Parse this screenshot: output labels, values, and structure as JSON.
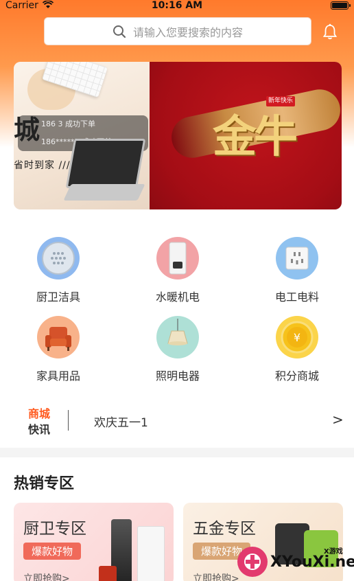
{
  "status_bar": {
    "carrier": "Carrier",
    "time": "10:16 AM"
  },
  "search": {
    "placeholder": "请输入您要搜索的内容"
  },
  "banner": {
    "ticker_row1": "186     3 成功下单",
    "ticker_row2": "186*****5 成功下单",
    "big_char": "城",
    "promo_line": "省时到家 ///",
    "badge": "新年快乐",
    "headline": "金牛"
  },
  "categories": [
    {
      "label": "厨卫洁具",
      "icon": "shower-head-icon"
    },
    {
      "label": "水暖机电",
      "icon": "water-heater-icon"
    },
    {
      "label": "电工电料",
      "icon": "power-socket-icon"
    },
    {
      "label": "家具用品",
      "icon": "sofa-icon"
    },
    {
      "label": "照明电器",
      "icon": "lamp-icon"
    },
    {
      "label": "积分商城",
      "icon": "coin-icon"
    }
  ],
  "news": {
    "tag_line1": "商城",
    "tag_line2": "快讯",
    "text": "欢庆五一1",
    "more": ">"
  },
  "hot": {
    "title": "热销专区",
    "zones": [
      {
        "title": "厨卫专区",
        "badge": "爆款好物",
        "buy": "立即抢购>",
        "color": "#f06a5a"
      },
      {
        "title": "五金专区",
        "badge": "爆款好物",
        "buy": "立即抢购>",
        "color": "#d9a574"
      }
    ]
  },
  "watermark": {
    "brand": "XYouXi.net",
    "small": "X游戏"
  },
  "colors": {
    "accent": "#ff7a2c",
    "news_tag": "#ff5a1f"
  }
}
